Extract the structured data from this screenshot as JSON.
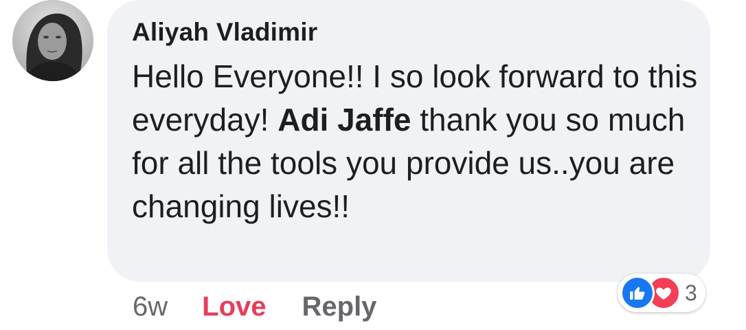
{
  "comment": {
    "author": "Aliyah Vladimir",
    "text_before_mention": "Hello Everyone!! I so look forward to this everyday! ",
    "mention": "Adi Jaffe",
    "text_after_mention": " thank you so much for all the tools you provide us..you are changing lives!!"
  },
  "reactions": {
    "icons": [
      "like-icon",
      "love-icon"
    ],
    "count": "3",
    "like_color": "#1877f2",
    "love_color": "#f33e58"
  },
  "actions": {
    "timestamp": "6w",
    "love_label": "Love",
    "love_color": "#e73d5b",
    "reply_label": "Reply"
  },
  "colors": {
    "bubble": "#f0f2f5",
    "text": "#1c1e21",
    "secondary": "#65676b"
  }
}
